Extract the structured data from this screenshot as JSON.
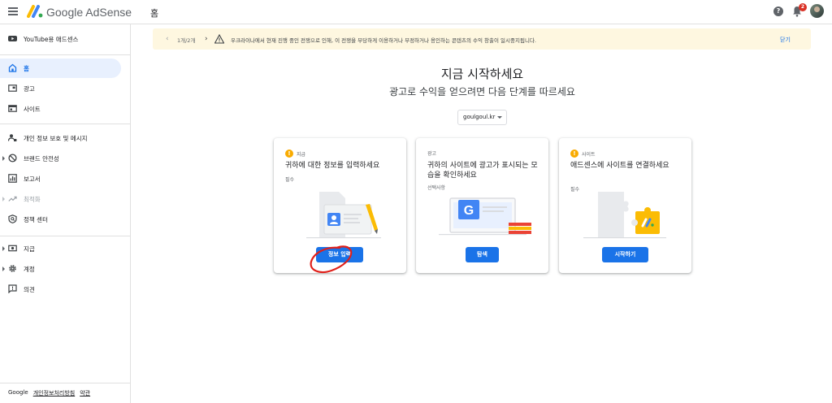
{
  "app": {
    "brand": "Google AdSense",
    "page_heading": "홈",
    "notification_count": "2"
  },
  "sidebar": {
    "youtube": "YouTube용 애드센스",
    "items": [
      {
        "label": "홈"
      },
      {
        "label": "광고"
      },
      {
        "label": "사이트"
      },
      {
        "label": "개인 정보 보호 및 메시지"
      },
      {
        "label": "브랜드 안전성"
      },
      {
        "label": "보고서"
      },
      {
        "label": "최적화"
      },
      {
        "label": "정책 센터"
      },
      {
        "label": "지급"
      },
      {
        "label": "계정"
      },
      {
        "label": "의견"
      }
    ],
    "footer": {
      "google": "Google",
      "privacy": "개인정보처리방침",
      "terms": "약관"
    }
  },
  "banner": {
    "pager": "1개/2개",
    "message": "우크라이나에서 현재 진행 중인 전쟁으로 인해, 이 전쟁을 부당하게 이용하거나 부정하거나 용인하는 콘텐츠의 수익 창출이 일시중지됩니다.",
    "close": "닫기"
  },
  "main": {
    "title": "지금 시작하세요",
    "subtitle": "광고로 수익을 얻으려면 다음 단계를 따르세요",
    "site": "goulgoul.kr"
  },
  "cards": [
    {
      "tag": "지급",
      "title": "귀하에 대한 정보를 입력하세요",
      "requirement": "필수",
      "button": "정보 입력"
    },
    {
      "tag": "광고",
      "title": "귀하의 사이트에 광고가 표시되는 모습을 확인하세요",
      "requirement": "선택사항",
      "button": "탐색"
    },
    {
      "tag": "사이트",
      "title": "애드센스에 사이트를 연결하세요",
      "requirement": "필수",
      "button": "시작하기"
    }
  ],
  "colors": {
    "accent": "#1a73e8",
    "banner_bg": "#fef7e0",
    "annotation": "#e0201a",
    "warning": "#f9ab00"
  }
}
